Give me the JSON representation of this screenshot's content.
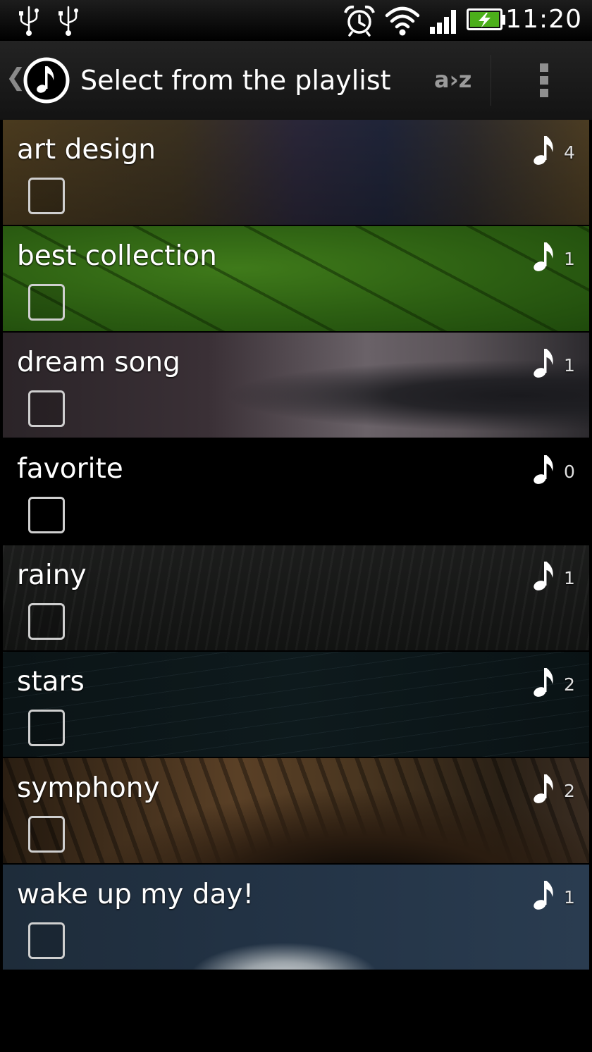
{
  "status_bar": {
    "time": "11:20",
    "icons": [
      "usb-icon",
      "usb-icon",
      "alarm-clock-icon",
      "wifi-icon",
      "signal-icon",
      "battery-charging-icon"
    ]
  },
  "action_bar": {
    "title": "Select from the playlist",
    "sort_label": "a›z",
    "icons": [
      "back-chevron-icon",
      "music-app-icon",
      "overflow-menu-icon"
    ]
  },
  "playlists": [
    {
      "name": "art design",
      "count": "4",
      "checked": false,
      "background": "city at dusk"
    },
    {
      "name": "best collection",
      "count": "1",
      "checked": false,
      "background": "green leaf"
    },
    {
      "name": "dream song",
      "count": "1",
      "checked": false,
      "background": "storm clouds"
    },
    {
      "name": "favorite",
      "count": "0",
      "checked": false,
      "background": "none"
    },
    {
      "name": "rainy",
      "count": "1",
      "checked": false,
      "background": "rainy street"
    },
    {
      "name": "stars",
      "count": "2",
      "checked": false,
      "background": "star trails"
    },
    {
      "name": "symphony",
      "count": "2",
      "checked": false,
      "background": "spiral staircase"
    },
    {
      "name": "wake up my day!",
      "count": "1",
      "checked": false,
      "background": "blue sky"
    }
  ],
  "colors": {
    "background": "#000000",
    "action_bar": "#1b1b1b",
    "text": "#ffffff",
    "secondary_text": "#9a9a9a",
    "battery": "#4caf1a"
  }
}
